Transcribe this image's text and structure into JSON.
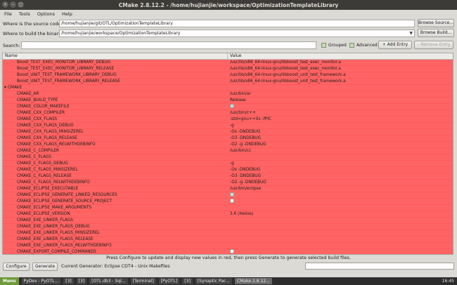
{
  "window": {
    "title": "CMake 2.8.12.2 - /home/hujianjie/workspace/OptimizationTemplateLibrary",
    "controls": [
      "×",
      "–",
      "□"
    ]
  },
  "menu": [
    "File",
    "Tools",
    "Options",
    "Help"
  ],
  "source": {
    "label": "Where is the source code:",
    "value": "/home/hujianjie/git/OTL/OptimizationTemplateLibrary",
    "button": "Browse Source..."
  },
  "binaries": {
    "label": "Where to build the binaries:",
    "value": "/home/hujianjie/workspace/OptimizationTemplateLibrary",
    "button": "Browse Build..."
  },
  "search": {
    "label": "Search:",
    "value": ""
  },
  "options": {
    "grouped": "Grouped",
    "advanced": "Advanced",
    "add_entry": "Add Entry",
    "remove_entry": "Remove Entry"
  },
  "table": {
    "headers": [
      "Name",
      "Value"
    ],
    "rows": [
      {
        "name": "Boost_TEST_EXEC_MONITOR_LIBRARY_DEBUG",
        "value": "/usr/lib/x86_64-linux-gnu/libboost_test_exec_monitor.a",
        "type": "text",
        "indent": 1
      },
      {
        "name": "Boost_TEST_EXEC_MONITOR_LIBRARY_RELEASE",
        "value": "/usr/lib/x86_64-linux-gnu/libboost_test_exec_monitor.a",
        "type": "text",
        "indent": 1
      },
      {
        "name": "Boost_UNIT_TEST_FRAMEWORK_LIBRARY_DEBUG",
        "value": "/usr/lib/x86_64-linux-gnu/libboost_unit_test_framework.a",
        "type": "text",
        "indent": 1
      },
      {
        "name": "Boost_UNIT_TEST_FRAMEWORK_LIBRARY_RELEASE",
        "value": "/usr/lib/x86_64-linux-gnu/libboost_unit_test_framework.a",
        "type": "text",
        "indent": 1
      },
      {
        "name": "CMAKE",
        "value": "",
        "type": "group",
        "indent": 0
      },
      {
        "name": "CMAKE_AR",
        "value": "/usr/bin/ar",
        "type": "text",
        "indent": 2
      },
      {
        "name": "CMAKE_BUILD_TYPE",
        "value": "Release",
        "type": "text",
        "indent": 2
      },
      {
        "name": "CMAKE_COLOR_MAKEFILE",
        "value": "",
        "type": "check_on",
        "indent": 2
      },
      {
        "name": "CMAKE_CXX_COMPILER",
        "value": "/usr/bin/c++",
        "type": "text",
        "indent": 2
      },
      {
        "name": "CMAKE_CXX_FLAGS",
        "value": "-std=gnu++0x -fPIC",
        "type": "text",
        "indent": 2
      },
      {
        "name": "CMAKE_CXX_FLAGS_DEBUG",
        "value": "-g",
        "type": "text",
        "indent": 2
      },
      {
        "name": "CMAKE_CXX_FLAGS_MINSIZEREL",
        "value": "-Os -DNDEBUG",
        "type": "text",
        "indent": 2
      },
      {
        "name": "CMAKE_CXX_FLAGS_RELEASE",
        "value": "-O3 -DNDEBUG",
        "type": "text",
        "indent": 2
      },
      {
        "name": "CMAKE_CXX_FLAGS_RELWITHDEBINFO",
        "value": "-O2 -g -DNDEBUG",
        "type": "text",
        "indent": 2
      },
      {
        "name": "CMAKE_C_COMPILER",
        "value": "/usr/bin/cc",
        "type": "text",
        "indent": 2
      },
      {
        "name": "CMAKE_C_FLAGS",
        "value": "",
        "type": "text",
        "indent": 2
      },
      {
        "name": "CMAKE_C_FLAGS_DEBUG",
        "value": "-g",
        "type": "text",
        "indent": 2
      },
      {
        "name": "CMAKE_C_FLAGS_MINSIZEREL",
        "value": "-Os -DNDEBUG",
        "type": "text",
        "indent": 2
      },
      {
        "name": "CMAKE_C_FLAGS_RELEASE",
        "value": "-O3 -DNDEBUG",
        "type": "text",
        "indent": 2
      },
      {
        "name": "CMAKE_C_FLAGS_RELWITHDEBINFO",
        "value": "-O2 -g -DNDEBUG",
        "type": "text",
        "indent": 2
      },
      {
        "name": "CMAKE_ECLIPSE_EXECUTABLE",
        "value": "/usr/bin/eclipse",
        "type": "text",
        "indent": 2
      },
      {
        "name": "CMAKE_ECLIPSE_GENERATE_LINKED_RESOURCES",
        "value": "",
        "type": "check_on",
        "indent": 2
      },
      {
        "name": "CMAKE_ECLIPSE_GENERATE_SOURCE_PROJECT",
        "value": "",
        "type": "check_off",
        "indent": 2
      },
      {
        "name": "CMAKE_ECLIPSE_MAKE_ARGUMENTS",
        "value": "",
        "type": "text",
        "indent": 2
      },
      {
        "name": "CMAKE_ECLIPSE_VERSION",
        "value": "3.6 (Helios)",
        "type": "text",
        "indent": 2
      },
      {
        "name": "CMAKE_EXE_LINKER_FLAGS",
        "value": "",
        "type": "text",
        "indent": 2
      },
      {
        "name": "CMAKE_EXE_LINKER_FLAGS_DEBUG",
        "value": "",
        "type": "text",
        "indent": 2
      },
      {
        "name": "CMAKE_EXE_LINKER_FLAGS_MINSIZEREL",
        "value": "",
        "type": "text",
        "indent": 2
      },
      {
        "name": "CMAKE_EXE_LINKER_FLAGS_RELEASE",
        "value": "",
        "type": "text",
        "indent": 2
      },
      {
        "name": "CMAKE_EXE_LINKER_FLAGS_RELWITHDEBINFO",
        "value": "",
        "type": "text",
        "indent": 2
      },
      {
        "name": "CMAKE_EXPORT_COMPILE_COMMANDS",
        "value": "",
        "type": "check_off",
        "indent": 2
      }
    ]
  },
  "status_message": "Press Configure to update and display new values in red, then press Generate to generate selected build files.",
  "bottom": {
    "configure": "Configure",
    "generate": "Generate",
    "generator": "Current Generator: Eclipse CDT4 - Unix Makefiles"
  },
  "taskbar": {
    "menu": "Menu",
    "tasks": [
      "PyDev - PyOTL...",
      "[3]",
      "[3]",
      "[OTL.db3 - Sql...",
      "[Terminal]",
      "[PyOTL]",
      "[3]",
      "[Synaptic Pac...",
      "CMake 2.8.12..."
    ],
    "clock": "16:45"
  },
  "colors": {
    "changed_row": "#ff6464",
    "titlebar": "#3c3b37",
    "window_bg": "#dcdad5"
  }
}
